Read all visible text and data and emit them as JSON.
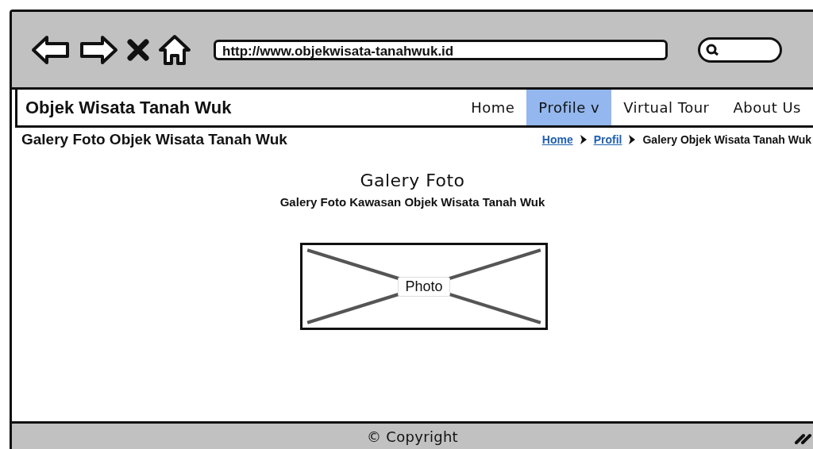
{
  "browser": {
    "url": "http://www.objekwisata-tanahwuk.id"
  },
  "navbar": {
    "brand": "Objek Wisata Tanah Wuk",
    "items": [
      {
        "label": "Home",
        "selected": false
      },
      {
        "label": "Profile v",
        "selected": true
      },
      {
        "label": "Virtual Tour",
        "selected": false
      },
      {
        "label": "About Us",
        "selected": false
      }
    ]
  },
  "page_title": "Galery Foto Objek Wisata Tanah Wuk",
  "breadcrumb": [
    {
      "label": "Home",
      "kind": "link"
    },
    {
      "label": "Profil",
      "kind": "link"
    },
    {
      "label": "Galery Objek Wisata Tanah Wuk",
      "kind": "current"
    }
  ],
  "content": {
    "heading": "Galery Foto",
    "subheading": "Galery Foto Kawasan Objek Wisata Tanah Wuk",
    "photo_label": "Photo"
  },
  "footer": {
    "copyright": "© Copyright"
  }
}
